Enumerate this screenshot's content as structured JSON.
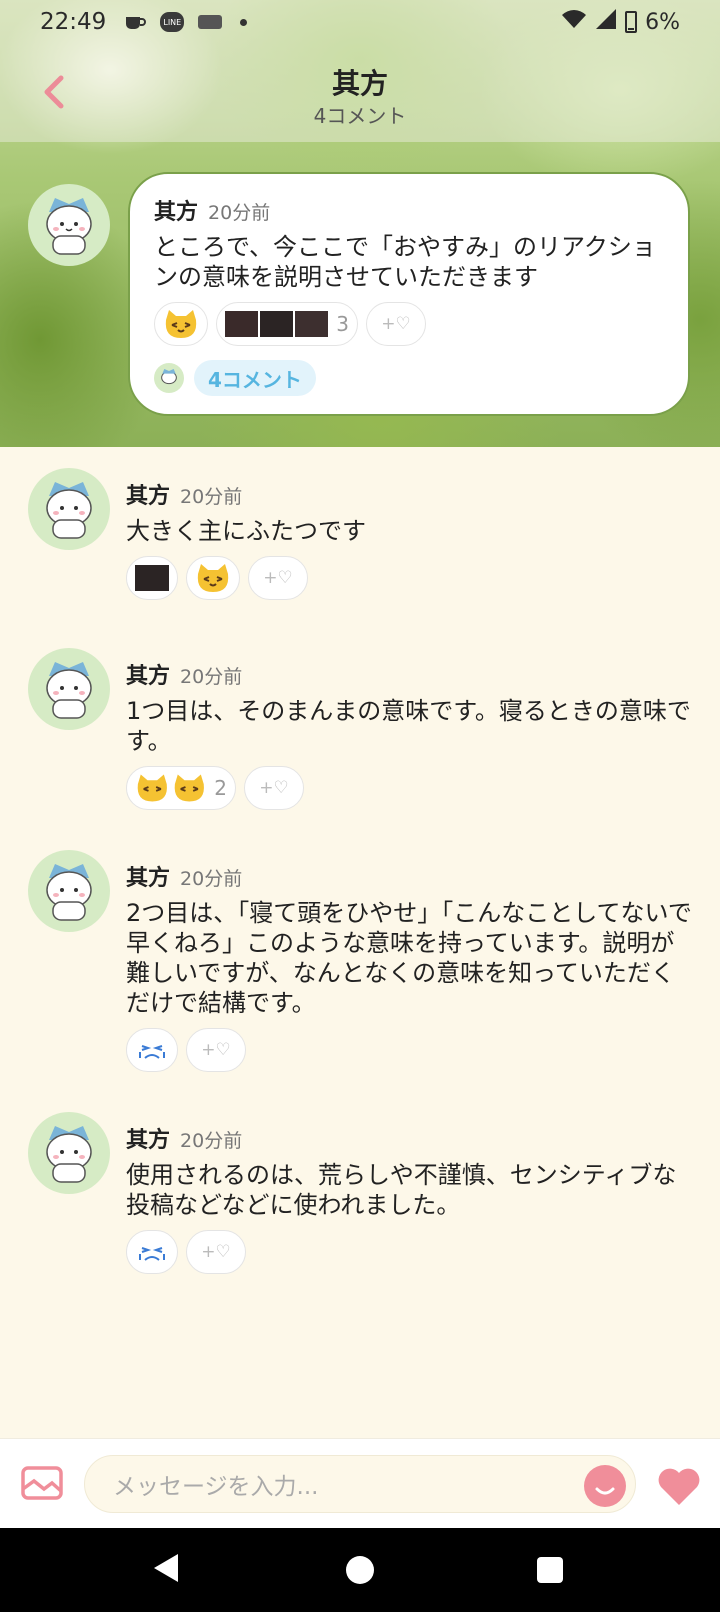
{
  "status_bar": {
    "time": "22:49",
    "battery": "6%",
    "line_label": "LINE"
  },
  "header": {
    "title": "其方",
    "subtitle": "4コメント"
  },
  "post": {
    "name": "其方",
    "time": "20分前",
    "text": "ところで、今ここで「おやすみ」のリアクションの意味を説明させていただきます",
    "reactions": [
      {
        "icon": "cat-smile-icon"
      },
      {
        "icon": "photo-thumbnails",
        "count": "3"
      },
      {
        "icon": "add-heart-icon",
        "label": "+♡"
      }
    ],
    "comment_count": "4コメント"
  },
  "comments": [
    {
      "name": "其方",
      "time": "20分前",
      "text": "大きく主にふたつです",
      "add_label": "+♡"
    },
    {
      "name": "其方",
      "time": "20分前",
      "text": "1つ目は、そのまんまの意味です。寝るときの意味です。",
      "count": "2",
      "add_label": "+♡"
    },
    {
      "name": "其方",
      "time": "20分前",
      "text": "2つ目は、「寝て頭をひやせ」「こんなことしてないで早くねろ」このような意味を持っています。説明が難しいですが、なんとなくの意味を知っていただくだけで結構です。",
      "add_label": "+♡"
    },
    {
      "name": "其方",
      "time": "20分前",
      "text": "使用されるのは、荒らしや不謹慎、センシティブな投稿などなどに使われました。",
      "add_label": "+♡"
    }
  ],
  "input": {
    "placeholder": "メッセージを入力..."
  },
  "colors": {
    "accent_pink": "#f08e9a",
    "comment_blue": "#56b5e0",
    "background": "#fdf8e9"
  }
}
